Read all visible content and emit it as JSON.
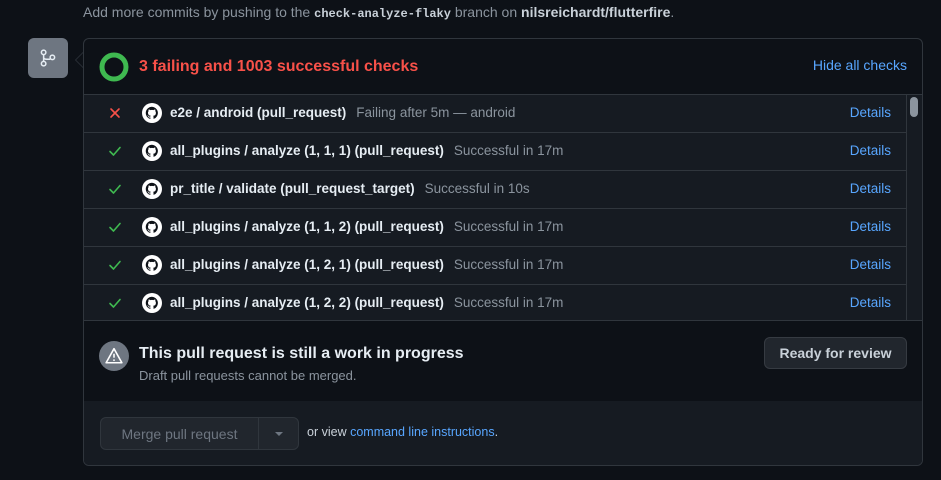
{
  "top_note": {
    "prefix": "Add more commits by pushing to the",
    "branch": "check-analyze-flaky",
    "middle": "branch on",
    "repo": "nilsreichardt/flutterfire",
    "suffix": "."
  },
  "summary": {
    "title": "3 failing and 1003 successful checks",
    "hide_label": "Hide all checks"
  },
  "checks": [
    {
      "status": "failing",
      "name": "e2e / android (pull_request)",
      "desc": "Failing after 5m — android",
      "details": "Details"
    },
    {
      "status": "success",
      "name": "all_plugins / analyze (1, 1, 1) (pull_request)",
      "desc": "Successful in 17m",
      "details": "Details"
    },
    {
      "status": "success",
      "name": "pr_title / validate (pull_request_target)",
      "desc": "Successful in 10s",
      "details": "Details"
    },
    {
      "status": "success",
      "name": "all_plugins / analyze (1, 1, 2) (pull_request)",
      "desc": "Successful in 17m",
      "details": "Details"
    },
    {
      "status": "success",
      "name": "all_plugins / analyze (1, 2, 1) (pull_request)",
      "desc": "Successful in 17m",
      "details": "Details"
    },
    {
      "status": "success",
      "name": "all_plugins / analyze (1, 2, 2) (pull_request)",
      "desc": "Successful in 17m",
      "details": "Details"
    }
  ],
  "wip": {
    "title": "This pull request is still a work in progress",
    "subtitle": "Draft pull requests cannot be merged.",
    "ready_label": "Ready for review"
  },
  "merge": {
    "button_label": "Merge pull request",
    "hint_prefix": "or view",
    "hint_link": "command line instructions",
    "hint_suffix": "."
  },
  "colors": {
    "failing": "#f85149",
    "success": "#3fb950",
    "link": "#58a6ff"
  },
  "icons": {
    "timeline": "git-pull-request-icon",
    "check_source": "github-icon",
    "failing": "x-icon",
    "success": "check-icon",
    "wip": "alert-icon",
    "merge_caret": "triangle-down-icon"
  }
}
